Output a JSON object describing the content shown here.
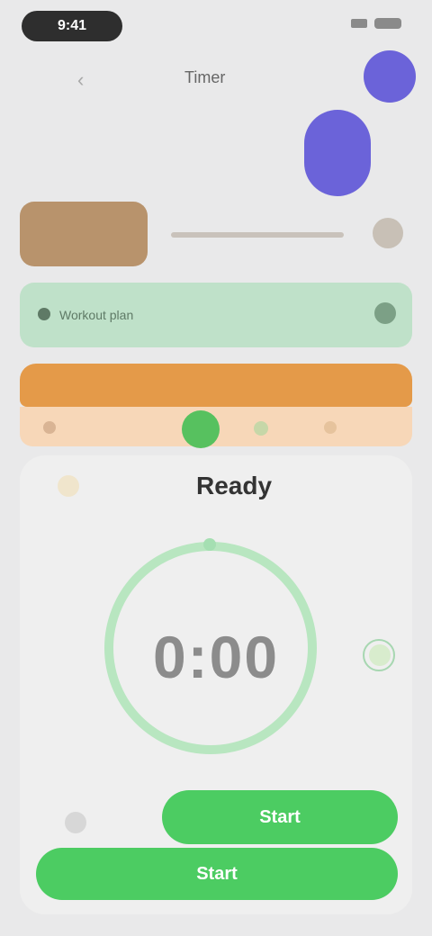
{
  "status_bar": {
    "time": "9:41"
  },
  "header": {
    "back_label": "‹",
    "title": "Timer"
  },
  "cards": {
    "brown": {
      "title": ""
    },
    "green": {
      "text": "Workout plan"
    }
  },
  "tabs": [
    "",
    "",
    "",
    ""
  ],
  "main": {
    "status": "Ready",
    "timer": "0:00",
    "primary_button": "Start",
    "secondary_button": "Start"
  }
}
